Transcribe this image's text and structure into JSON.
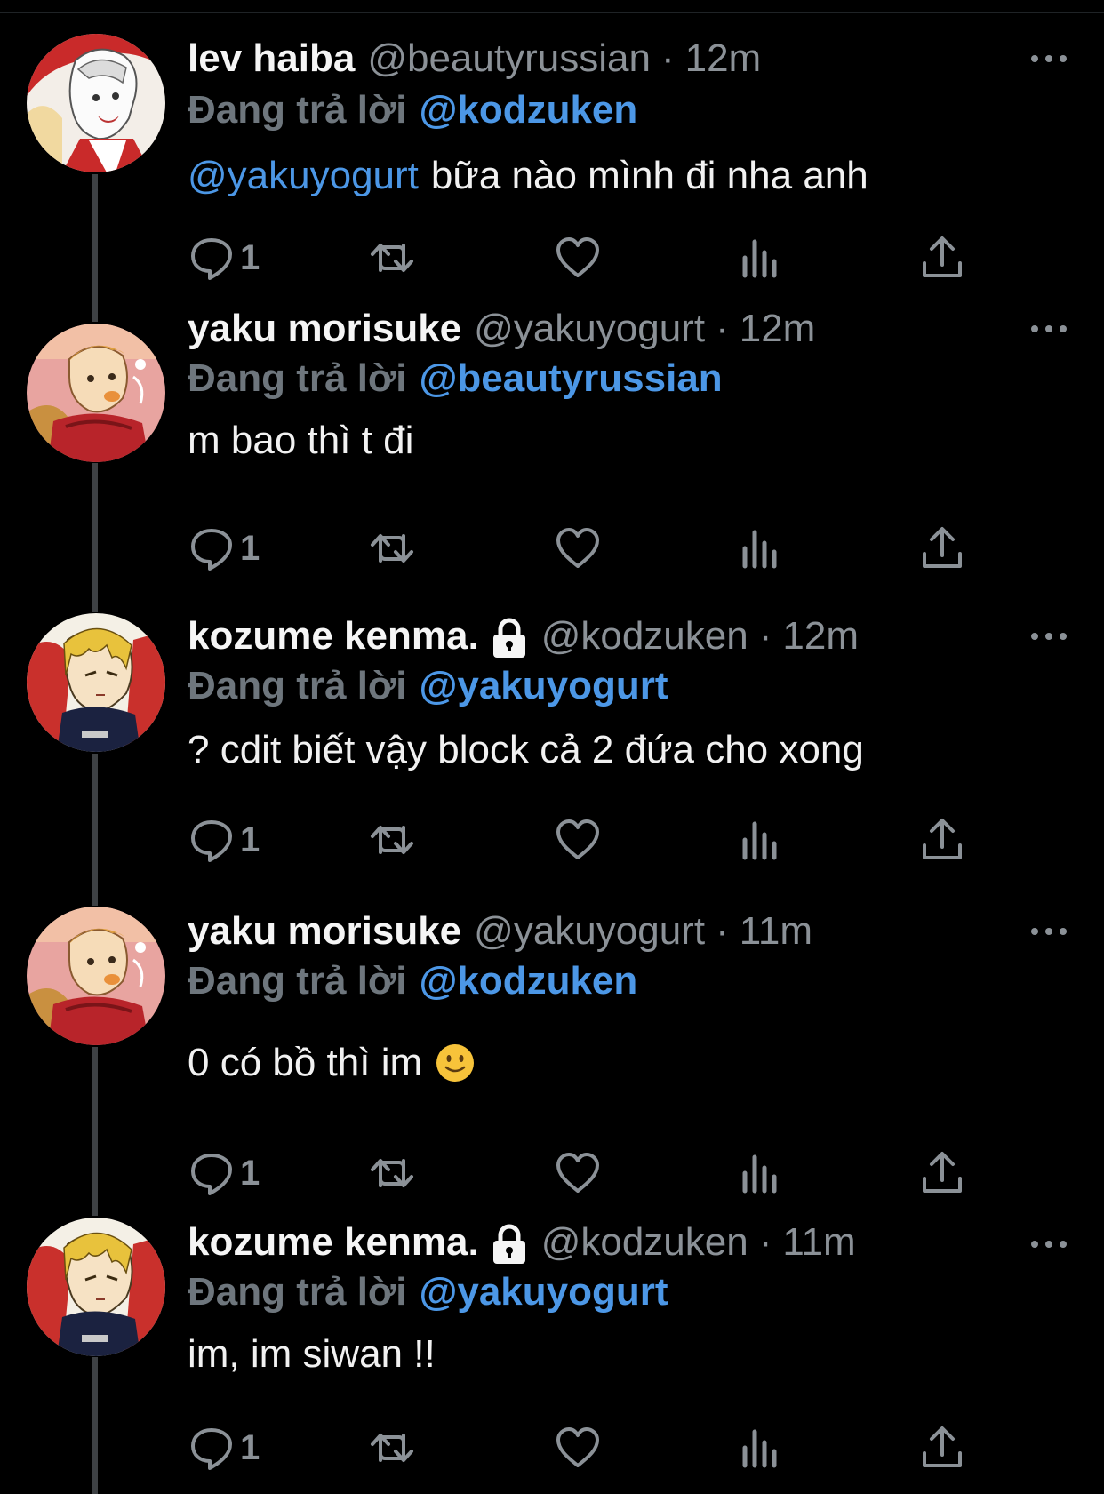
{
  "reply_prefix": "Đang trả lời",
  "colors": {
    "background": "#000000",
    "accent": "#4c97e6",
    "muted": "#8b9197",
    "thread_line": "#3e4144"
  },
  "icons": {
    "reply": "speech-bubble-icon",
    "retweet": "retweet-icon",
    "like": "heart-icon",
    "views": "bar-chart-icon",
    "share": "share-up-arrow-icon",
    "more": "more-dots-icon",
    "protected": "lock-icon"
  },
  "tweets": [
    {
      "name": "lev haiba",
      "protected": false,
      "handle": "@beautyrussian",
      "separator": "·",
      "time": "12m",
      "replying_to": "@kodzuken",
      "mention": "@yakuyogurt",
      "text": "bữa nào mình đi nha anh",
      "reply_count": "1",
      "avatar": "lev-haiba-avatar"
    },
    {
      "name": "yaku morisuke",
      "protected": false,
      "handle": "@yakuyogurt",
      "separator": "·",
      "time": "12m",
      "replying_to": "@beautyrussian",
      "mention": "",
      "text": "m bao thì t đi",
      "reply_count": "1",
      "avatar": "yaku-morisuke-avatar"
    },
    {
      "name": "kozume kenma.",
      "protected": true,
      "handle": "@kodzuken",
      "separator": "·",
      "time": "12m",
      "replying_to": "@yakuyogurt",
      "mention": "",
      "text": "? cdit biết vậy block cả 2 đứa cho xong",
      "reply_count": "1",
      "avatar": "kozume-kenma-avatar"
    },
    {
      "name": "yaku morisuke",
      "protected": false,
      "handle": "@yakuyogurt",
      "separator": "·",
      "time": "11m",
      "replying_to": "@kodzuken",
      "mention": "",
      "text": "0 có bồ thì im",
      "emoji": "slightly-smiling-face-emoji",
      "reply_count": "1",
      "avatar": "yaku-morisuke-avatar"
    },
    {
      "name": "kozume kenma.",
      "protected": true,
      "handle": "@kodzuken",
      "separator": "·",
      "time": "11m",
      "replying_to": "@yakuyogurt",
      "mention": "",
      "text": "im, im siwan !!",
      "reply_count": "1",
      "avatar": "kozume-kenma-avatar"
    }
  ]
}
